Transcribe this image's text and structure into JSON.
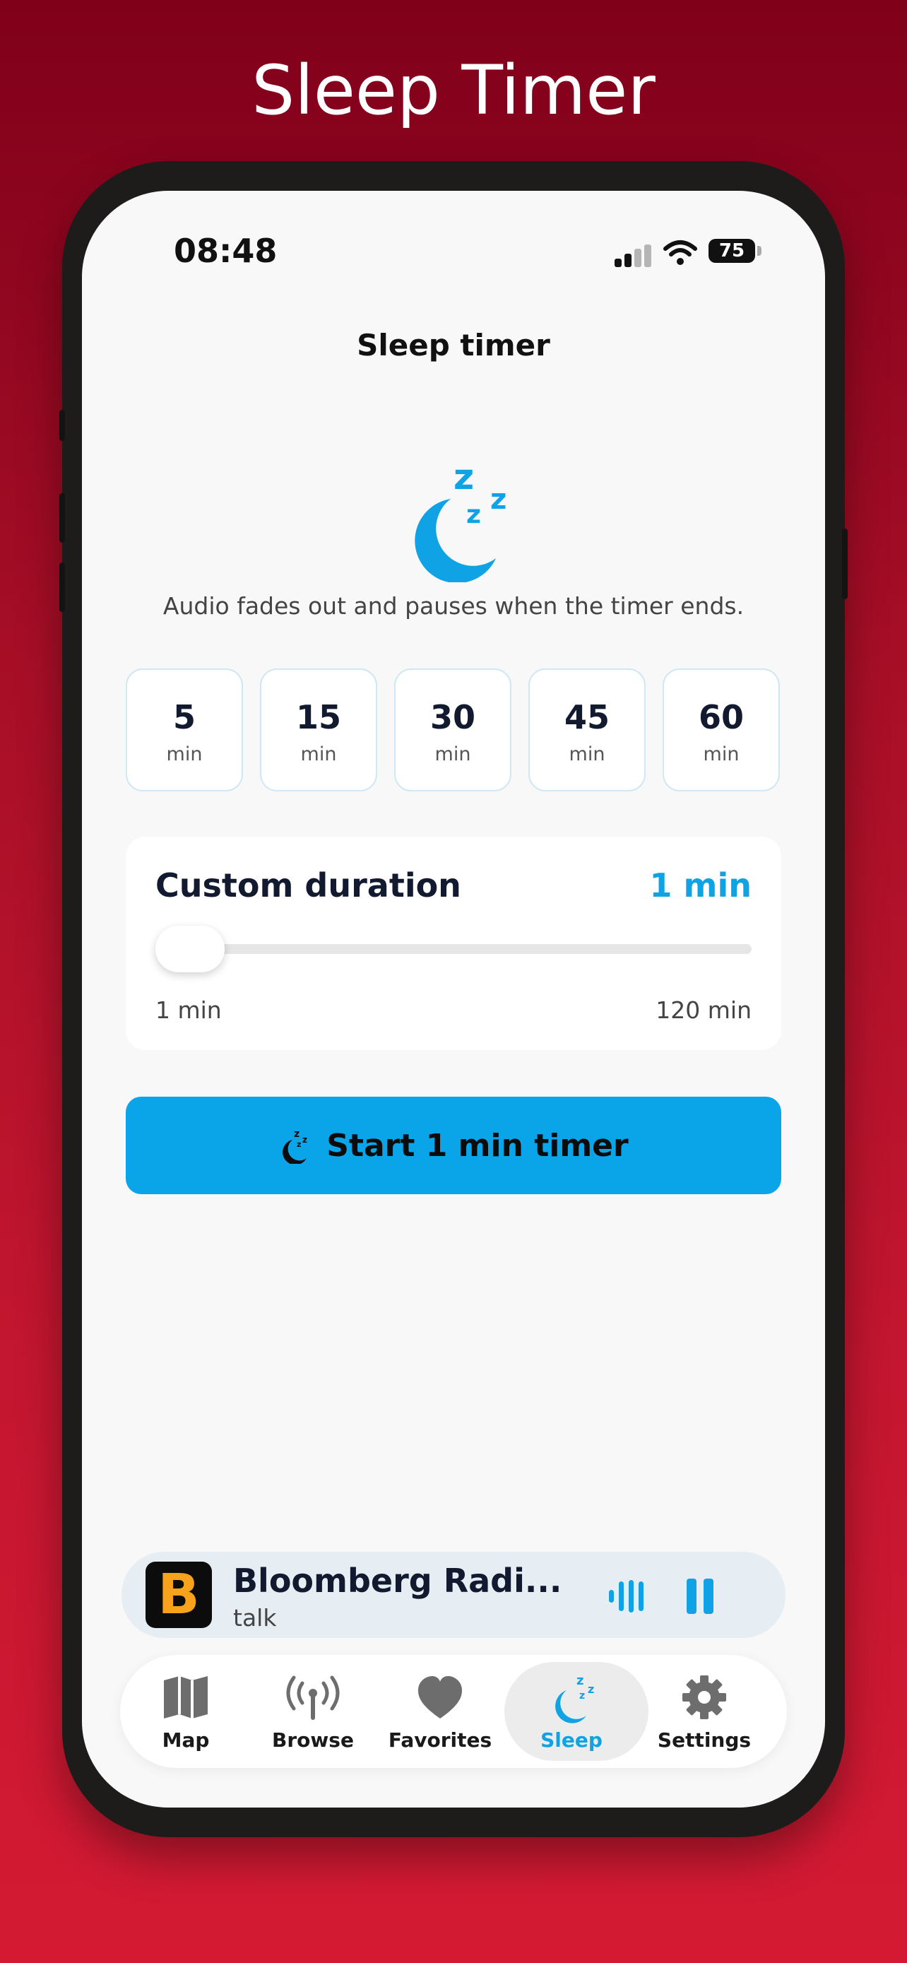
{
  "promo": {
    "title": "Sleep Timer"
  },
  "status_bar": {
    "time": "08:48",
    "battery": "75"
  },
  "screen": {
    "title": "Sleep timer",
    "description": "Audio fades out and pauses when the timer ends."
  },
  "presets": [
    {
      "value": "5",
      "unit": "min"
    },
    {
      "value": "15",
      "unit": "min"
    },
    {
      "value": "30",
      "unit": "min"
    },
    {
      "value": "45",
      "unit": "min"
    },
    {
      "value": "60",
      "unit": "min"
    }
  ],
  "custom": {
    "label": "Custom duration",
    "value": "1 min",
    "min_label": "1 min",
    "max_label": "120 min",
    "slider_fraction": 0.0
  },
  "start_button": {
    "label": "Start 1 min timer"
  },
  "now_playing": {
    "logo_letter": "B",
    "station": "Bloomberg Radi...",
    "genre": "talk"
  },
  "tabs": [
    {
      "label": "Map",
      "icon": "map-icon"
    },
    {
      "label": "Browse",
      "icon": "antenna-icon"
    },
    {
      "label": "Favorites",
      "icon": "heart-icon"
    },
    {
      "label": "Sleep",
      "icon": "moon-zzz-icon",
      "active": true
    },
    {
      "label": "Settings",
      "icon": "gear-icon"
    }
  ],
  "colors": {
    "accent": "#0aa4e8",
    "background_top": "#80001a",
    "background_bottom": "#d41a33",
    "logo_orange": "#f6a21a"
  }
}
